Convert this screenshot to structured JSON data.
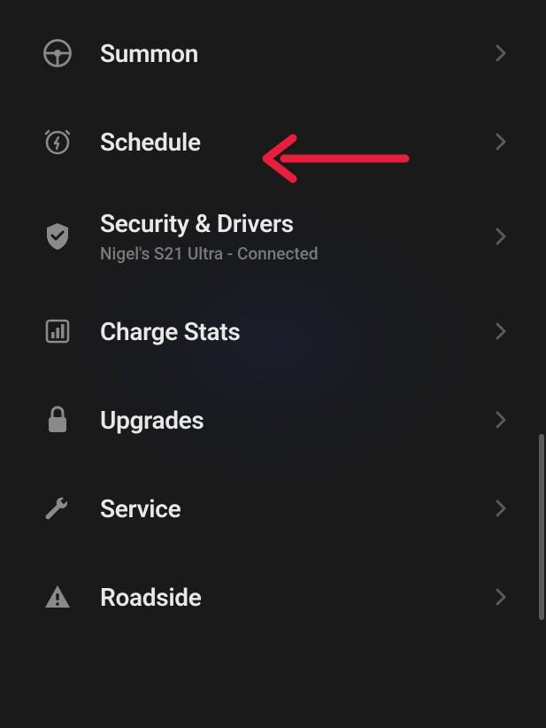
{
  "menu": {
    "items": [
      {
        "label": "Summon",
        "icon": "steering-wheel"
      },
      {
        "label": "Schedule",
        "icon": "clock-bolt"
      },
      {
        "label": "Security & Drivers",
        "sublabel": "Nigel's S21 Ultra - Connected",
        "icon": "shield-check"
      },
      {
        "label": "Charge Stats",
        "icon": "bar-chart"
      },
      {
        "label": "Upgrades",
        "icon": "lock"
      },
      {
        "label": "Service",
        "icon": "wrench"
      },
      {
        "label": "Roadside",
        "icon": "warning-triangle"
      }
    ]
  },
  "annotation": {
    "arrow_target": "Schedule",
    "arrow_color": "#e91e3c"
  }
}
